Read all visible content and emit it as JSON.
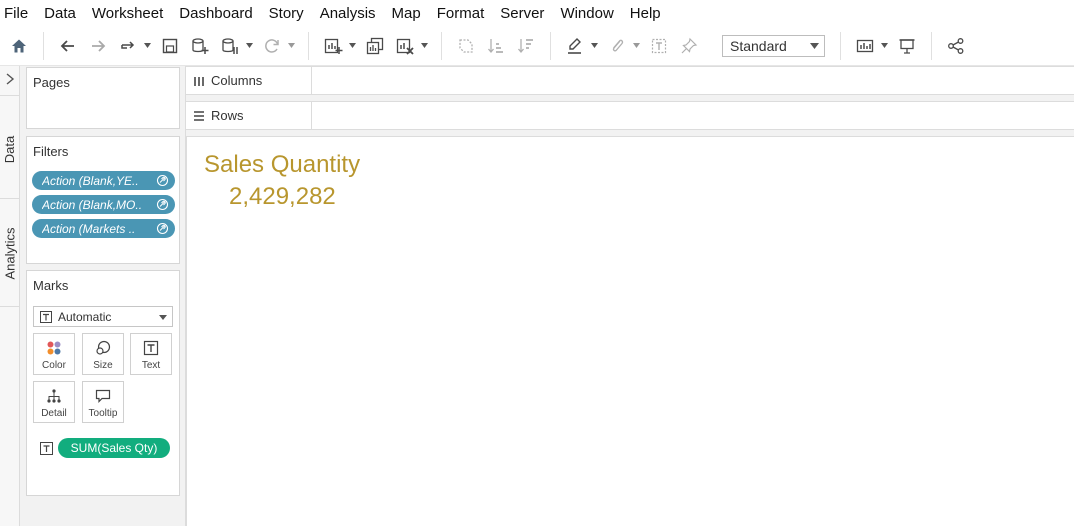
{
  "menu": [
    "File",
    "Data",
    "Worksheet",
    "Dashboard",
    "Story",
    "Analysis",
    "Map",
    "Format",
    "Server",
    "Window",
    "Help"
  ],
  "toolbar": {
    "fit_value": "Standard",
    "icons": [
      "home-icon",
      "undo-icon",
      "redo-icon",
      "replay-icon",
      "save-icon",
      "new-datasource-icon",
      "pause-updates-icon",
      "refresh-icon",
      "new-worksheet-icon",
      "duplicate-sheet-icon",
      "clear-sheet-icon",
      "swap-icon",
      "sort-ascending-icon",
      "sort-descending-icon",
      "highlight-icon",
      "group-icon",
      "labels-icon",
      "fix-axes-icon",
      "show-me-icon",
      "presentation-icon",
      "share-icon"
    ]
  },
  "sidebar": {
    "tabs": {
      "data": "Data",
      "analytics": "Analytics"
    },
    "pages": {
      "title": "Pages"
    },
    "filters": {
      "title": "Filters",
      "items": [
        "Action (Blank,YE..",
        "Action (Blank,MO..",
        "Action (Markets .."
      ]
    },
    "marks": {
      "title": "Marks",
      "type": "Automatic",
      "buttons": {
        "color": "Color",
        "size": "Size",
        "text": "Text",
        "detail": "Detail",
        "tooltip": "Tooltip"
      },
      "field": "SUM(Sales Qty)"
    }
  },
  "shelves": {
    "columns": "Columns",
    "rows": "Rows"
  },
  "viz": {
    "title": "Sales Quantity",
    "value": "2,429,282",
    "color": "#b8962e"
  },
  "colors": {
    "filter_pill": "#4a96b4",
    "measure_pill": "#12ad7e"
  }
}
